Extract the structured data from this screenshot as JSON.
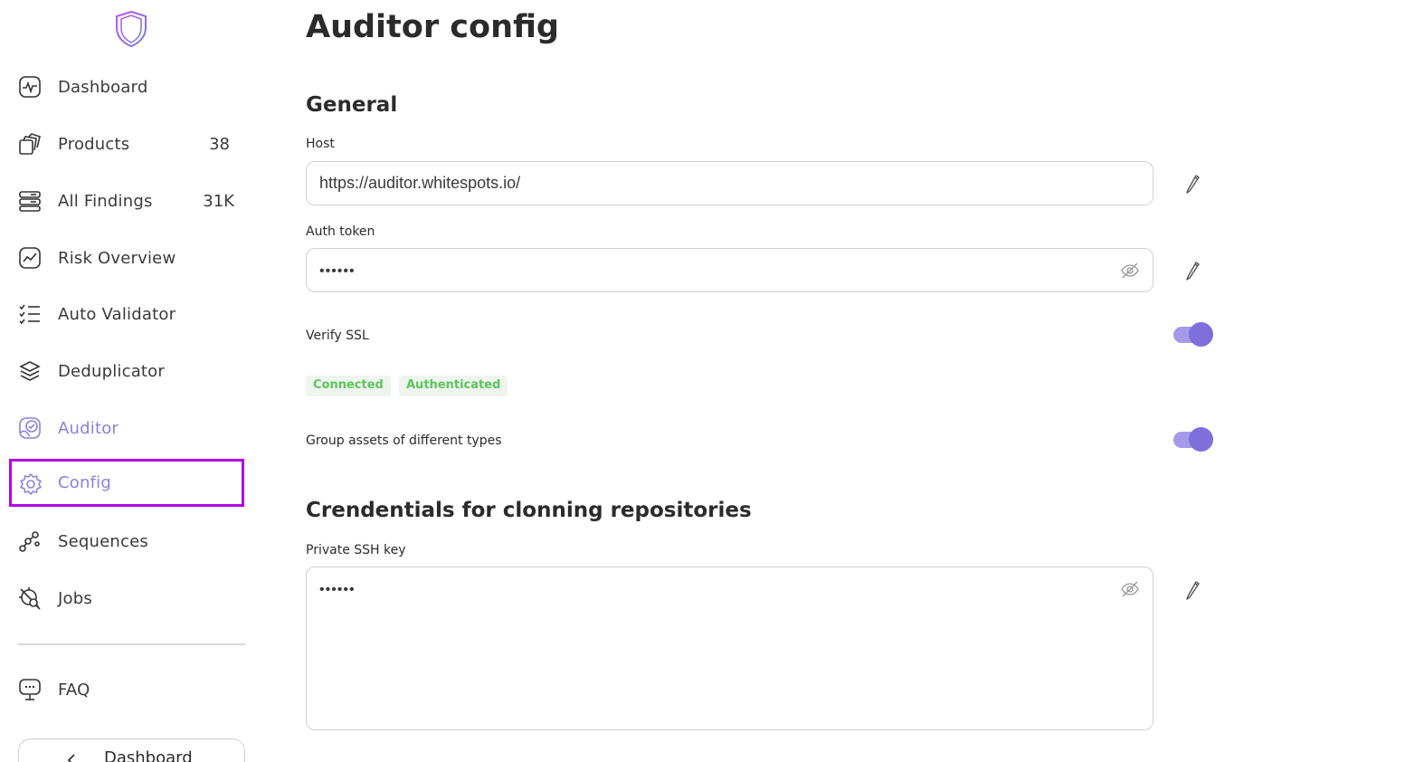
{
  "sidebar": {
    "items": [
      {
        "label": "Dashboard",
        "icon": "pulse-icon"
      },
      {
        "label": "Products",
        "count": "38",
        "icon": "layers-icon"
      },
      {
        "label": "All Findings",
        "count": "31K",
        "icon": "server-icon"
      },
      {
        "label": "Risk Overview",
        "icon": "trend-icon"
      },
      {
        "label": "Auto Validator",
        "icon": "checklist-icon"
      },
      {
        "label": "Deduplicator",
        "icon": "stack-icon"
      },
      {
        "label": "Auditor",
        "icon": "auditor-icon"
      },
      {
        "label": "Config",
        "icon": "gear-icon"
      },
      {
        "label": "Sequences",
        "icon": "sequence-icon"
      },
      {
        "label": "Jobs",
        "icon": "jobs-icon"
      }
    ],
    "faq_label": "FAQ",
    "dashboard_button_label": "Dashboard"
  },
  "main": {
    "title": "Auditor config",
    "general": {
      "title": "General",
      "host_label": "Host",
      "host_value": "https://auditor.whitespots.io/",
      "auth_token_label": "Auth token",
      "auth_token_value": "••••••",
      "verify_ssl_label": "Verify SSL",
      "verify_ssl_on": true,
      "status_connected": "Connected",
      "status_authenticated": "Authenticated",
      "group_assets_label": "Group assets of different types",
      "group_assets_on": true
    },
    "credentials": {
      "title": "Crendentials for clonning repositories",
      "ssh_key_label": "Private SSH key",
      "ssh_key_value": "••••••"
    }
  },
  "colors": {
    "accent": "#8b7fe0",
    "selection_outline": "#b300e6",
    "status_green": "#5cc65c"
  }
}
